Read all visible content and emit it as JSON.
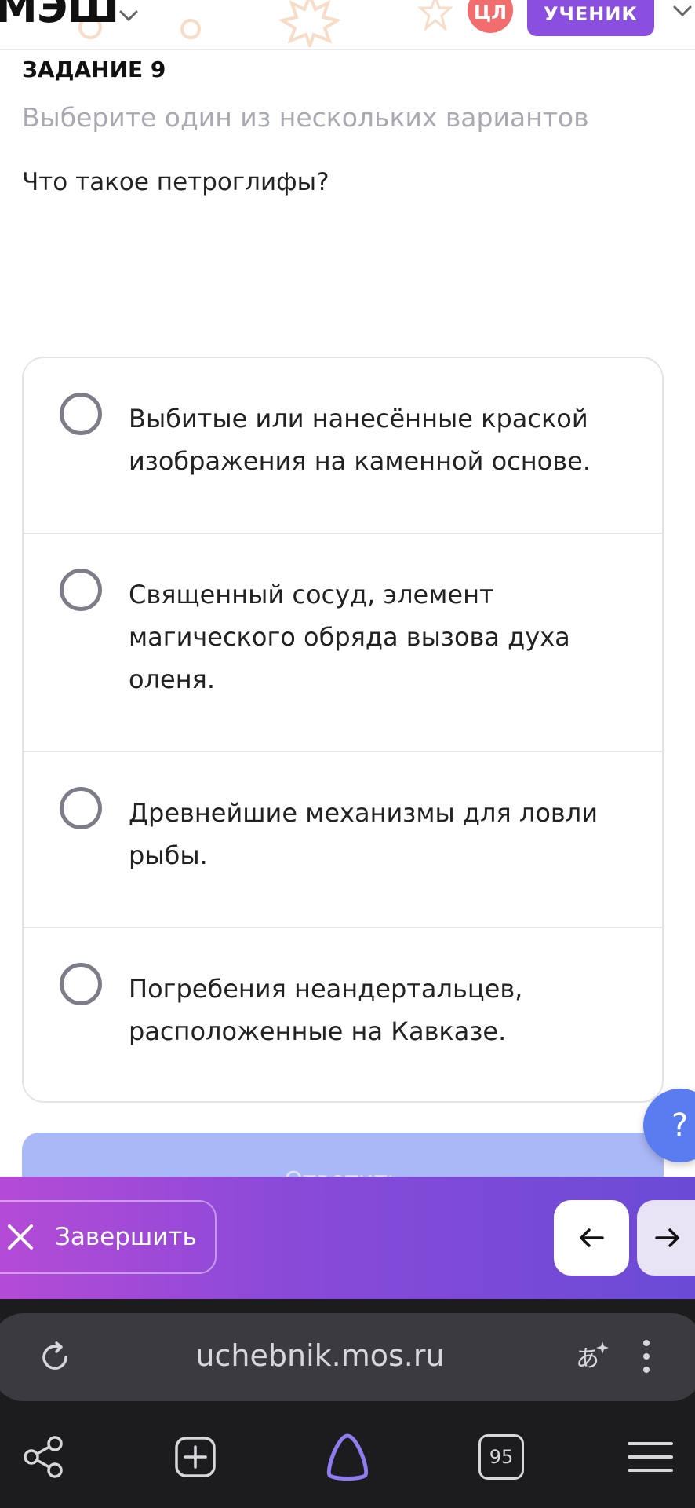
{
  "header": {
    "logo": "МЭШ",
    "badge": "ЦЛ",
    "role": "УЧЕНИК"
  },
  "task": {
    "title": "ЗАДАНИЕ 9",
    "hint": "Выберите один из нескольких вариантов",
    "question": "Что такое петроглифы?"
  },
  "options": [
    {
      "text": "Выбитые или нанесённые краской изображения на каменной основе.",
      "selected": false
    },
    {
      "text": "Священный сосуд, элемент магического обряда вызова духа оленя.",
      "selected": false
    },
    {
      "text": "Древнейшие механизмы для ловли рыбы.",
      "selected": false
    },
    {
      "text": "Погребения неандертальцев, расположенные на Кавказе.",
      "selected": false
    }
  ],
  "help_label": "?",
  "answer_label": "Ответить",
  "bottom_bar": {
    "finish_label": "Завершить"
  },
  "browser": {
    "url": "uchebnik.mos.ru",
    "tab_count": "95"
  },
  "colors": {
    "accent": "#8b4fe0",
    "badge": "#f26d6d",
    "help": "#5b7cf0",
    "answer_disabled": "#a9b8f6"
  }
}
